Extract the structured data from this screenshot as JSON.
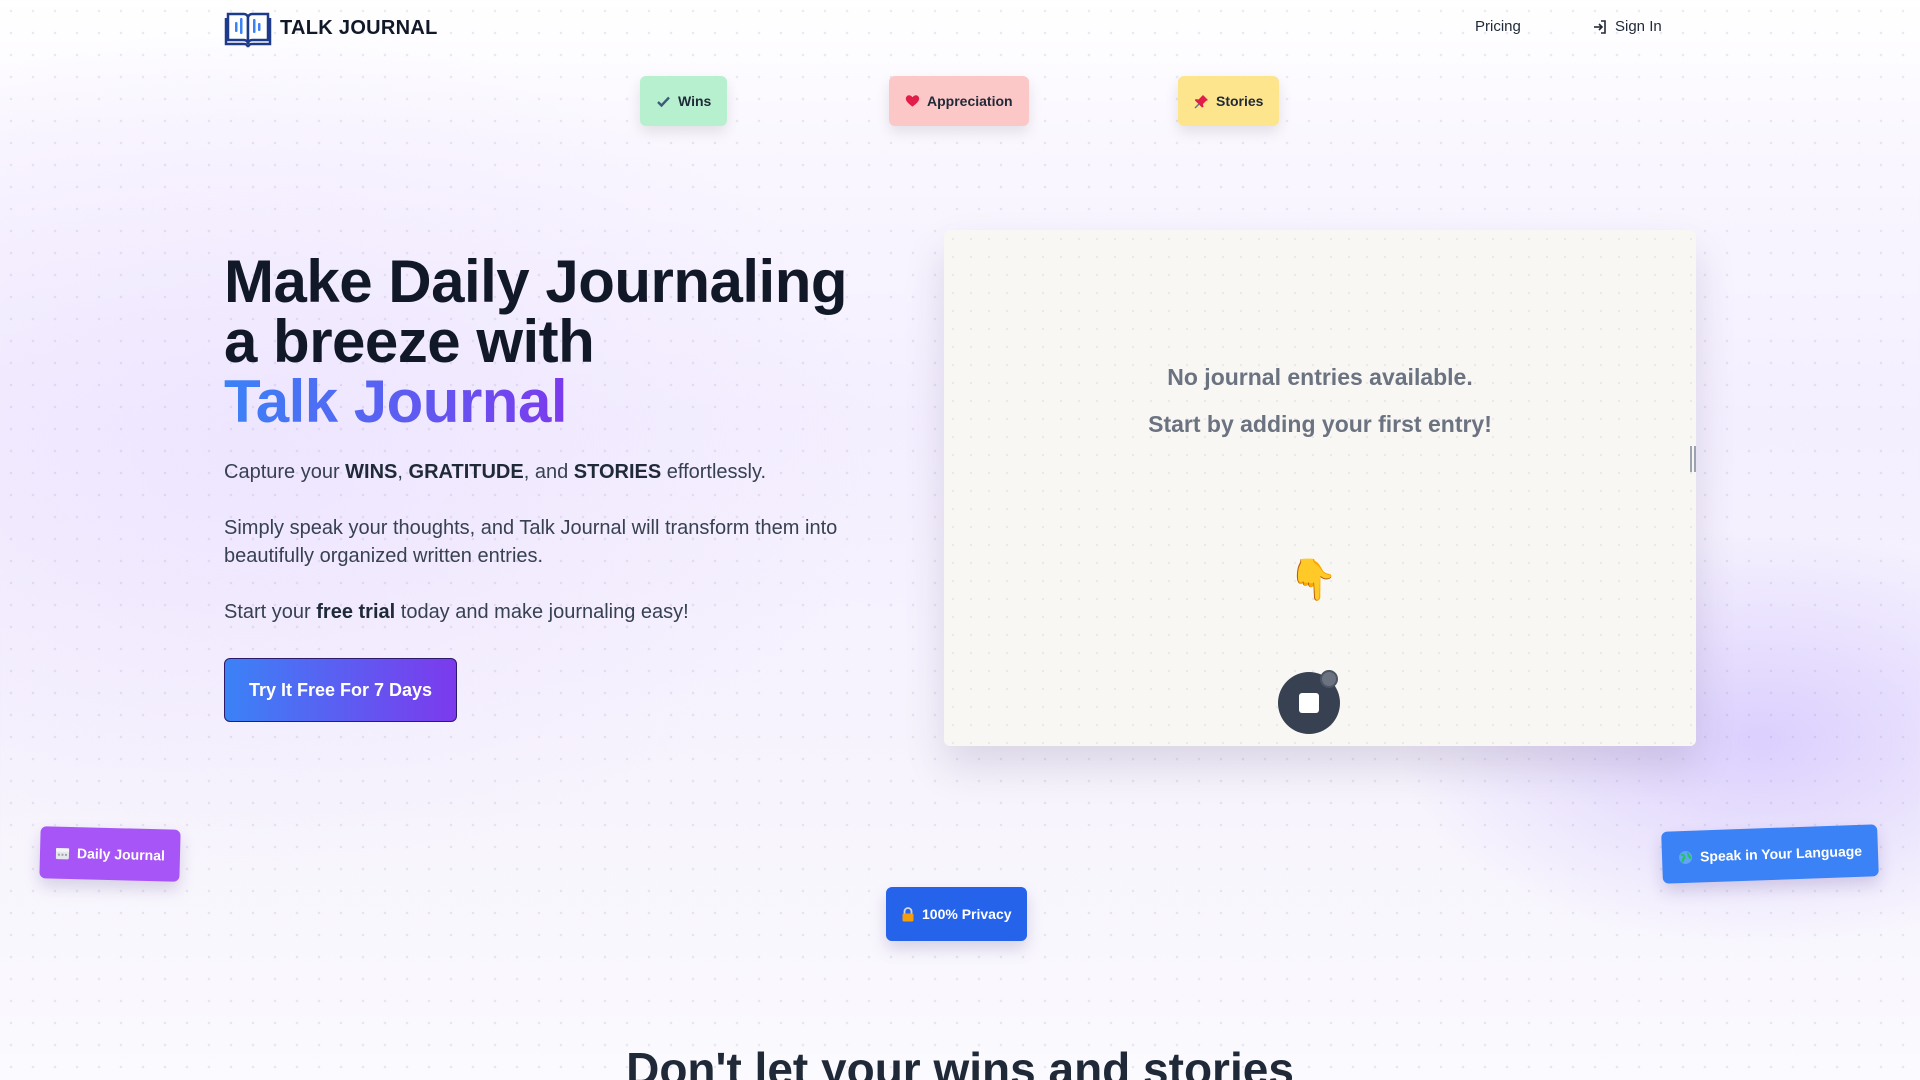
{
  "header": {
    "brand": "TALK JOURNAL",
    "nav": {
      "pricing": "Pricing",
      "sign_in": "Sign In"
    }
  },
  "tags": {
    "wins": {
      "label": "Wins",
      "icon": "check-icon"
    },
    "appreciation": {
      "label": "Appreciation",
      "icon": "heart-icon"
    },
    "stories": {
      "label": "Stories",
      "icon": "pin-icon"
    }
  },
  "hero": {
    "title_line1": "Make Daily Journaling",
    "title_line2": "a breeze with",
    "title_brand": "Talk Journal",
    "p1": {
      "pre": "Capture your ",
      "w1": "WINS",
      "sep1": ", ",
      "w2": "GRATITUDE",
      "sep2": ", and ",
      "w3": "STORIES",
      "post": " effortlessly."
    },
    "p2": "Simply speak your thoughts, and Talk Journal will transform them into beautifully organized written entries.",
    "p3": {
      "pre": "Start your ",
      "bold": "free trial",
      "post": " today and make journaling easy!"
    },
    "cta": "Try It Free For 7 Days"
  },
  "journal_card": {
    "empty_line1": "No journal entries available.",
    "empty_line2": "Start by adding your first entry!",
    "pointer": "👇"
  },
  "badges": {
    "daily": {
      "label": "Daily Journal",
      "icon": "calendar-icon"
    },
    "privacy": {
      "label": "100% Privacy",
      "icon": "lock-icon"
    },
    "language": {
      "label": "Speak in Your Language",
      "icon": "globe-icon"
    }
  },
  "section": {
    "heading": "Don't let your wins and stories"
  },
  "colors": {
    "accent_start": "#3b82f6",
    "accent_end": "#7c3aed",
    "wins": "#b7f0cf",
    "appreciation": "#fcc7c7",
    "stories": "#fde58e"
  }
}
